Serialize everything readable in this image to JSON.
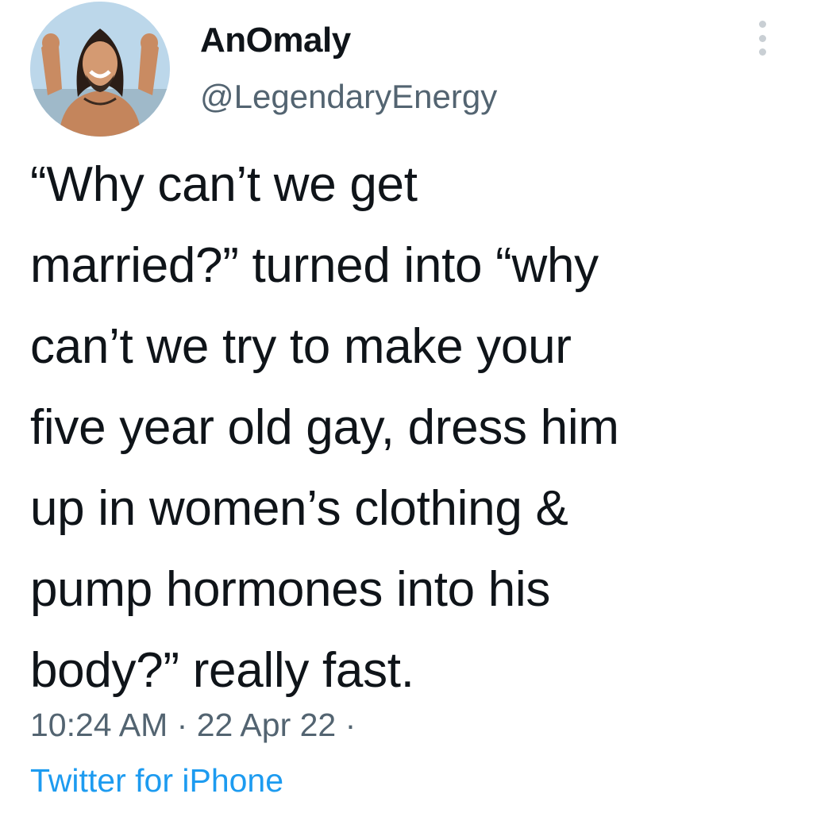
{
  "tweet": {
    "author": {
      "display_name": "AnOmaly",
      "handle": "@LegendaryEnergy",
      "avatar_icon": "user-avatar"
    },
    "more_icon": "more-dots-icon",
    "text_lines": [
      "“Why can’t we get",
      "married?” turned into “why",
      "can’t we try to make your",
      "five year old gay, dress him",
      "up in women’s clothing &",
      "pump hormones into his",
      "body?” really fast."
    ],
    "meta": {
      "time": "10:24 AM",
      "separator": "·",
      "date": "22 Apr 22",
      "trailing_separator": "·"
    },
    "source": "Twitter for iPhone",
    "colors": {
      "text": "#0f1419",
      "secondary": "#536471",
      "link": "#1d9bf0"
    }
  }
}
